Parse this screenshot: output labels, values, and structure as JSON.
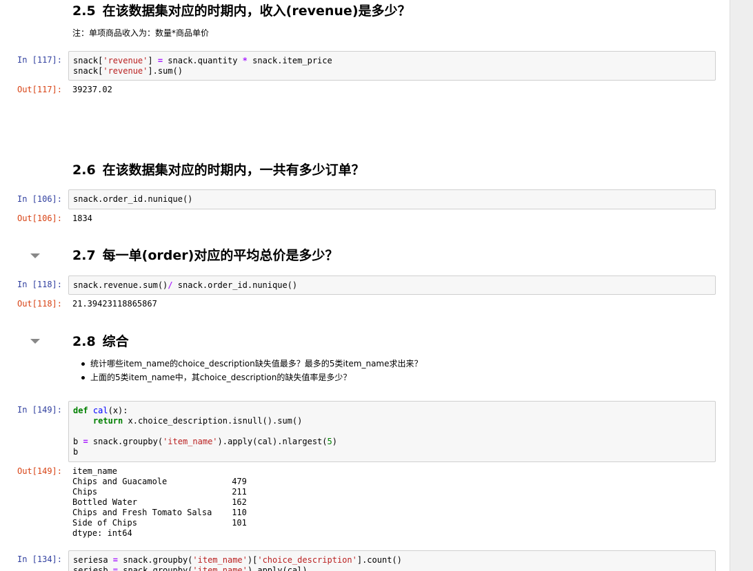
{
  "sections": {
    "s25": {
      "number": "2.5",
      "title": "在该数据集对应的时期内，收入(revenue)是多少？",
      "note": "注：单项商品收入为：数量*商品单价"
    },
    "s26": {
      "number": "2.6",
      "title": "在该数据集对应的时期内，一共有多少订单？"
    },
    "s27": {
      "number": "2.7",
      "title": "每一单(order)对应的平均总价是多少？"
    },
    "s28": {
      "number": "2.8",
      "title": "综合",
      "bullets": [
        "统计哪些item_name的choice_description缺失值最多？最多的5类item_name求出来？",
        "上面的5类item_name中，其choice_description的缺失值率是多少？"
      ]
    }
  },
  "cells": {
    "c117": {
      "in_prompt": "In  [117]:",
      "out_prompt": "Out[117]:",
      "code": {
        "l1_a": "snack[",
        "l1_b": "'revenue'",
        "l1_c": "] ",
        "l1_d": "=",
        "l1_e": " snack.quantity ",
        "l1_f": "*",
        "l1_g": " snack.item_price",
        "l2_a": "snack[",
        "l2_b": "'revenue'",
        "l2_c": "].sum()"
      },
      "output": "39237.02"
    },
    "c106": {
      "in_prompt": "In  [106]:",
      "out_prompt": "Out[106]:",
      "code": "snack.order_id.nunique()",
      "output": "1834"
    },
    "c118": {
      "in_prompt": "In  [118]:",
      "out_prompt": "Out[118]:",
      "code": {
        "a": "snack.revenue.sum()",
        "b": "/",
        "c": " snack.order_id.nunique()"
      },
      "output": "21.39423118865867"
    },
    "c149": {
      "in_prompt": "In  [149]:",
      "out_prompt": "Out[149]:",
      "code": {
        "l1_kw": "def",
        "l1_fn": "cal",
        "l1_rest": "(x):",
        "l2_indent": "    ",
        "l2_kw": "return",
        "l2_rest": " x.choice_description.isnull().sum()",
        "l4_a": "b ",
        "l4_b": "=",
        "l4_c": " snack.groupby(",
        "l4_d": "'item_name'",
        "l4_e": ").apply(cal).nlargest(",
        "l4_f": "5",
        "l4_g": ")",
        "l5": "b"
      },
      "output_lines": [
        "item_name",
        "Chips and Guacamole             479",
        "Chips                           211",
        "Bottled Water                   162",
        "Chips and Fresh Tomato Salsa    110",
        "Side of Chips                   101",
        "dtype: int64"
      ]
    },
    "c134": {
      "in_prompt": "In  [134]:",
      "code": {
        "l1_a": "seriesa ",
        "l1_b": "=",
        "l1_c": " snack.groupby(",
        "l1_d": "'item_name'",
        "l1_e": ")[",
        "l1_f": "'choice_description'",
        "l1_g": "].count()",
        "l2_a": "seriesb ",
        "l2_b": "=",
        "l2_c": " snack.groupby(",
        "l2_d": "'item_name'",
        "l2_e": ").apply(cal)"
      }
    }
  },
  "colors": {
    "in_prompt": "#303f9f",
    "out_prompt": "#d84315",
    "string": "#ba2121",
    "keyword": "#008000",
    "operator": "#aa22ff",
    "cell_bg": "#f7f7f7",
    "cell_border": "#cfcfcf"
  },
  "icons": {
    "collapse": "triangle-down-icon"
  }
}
